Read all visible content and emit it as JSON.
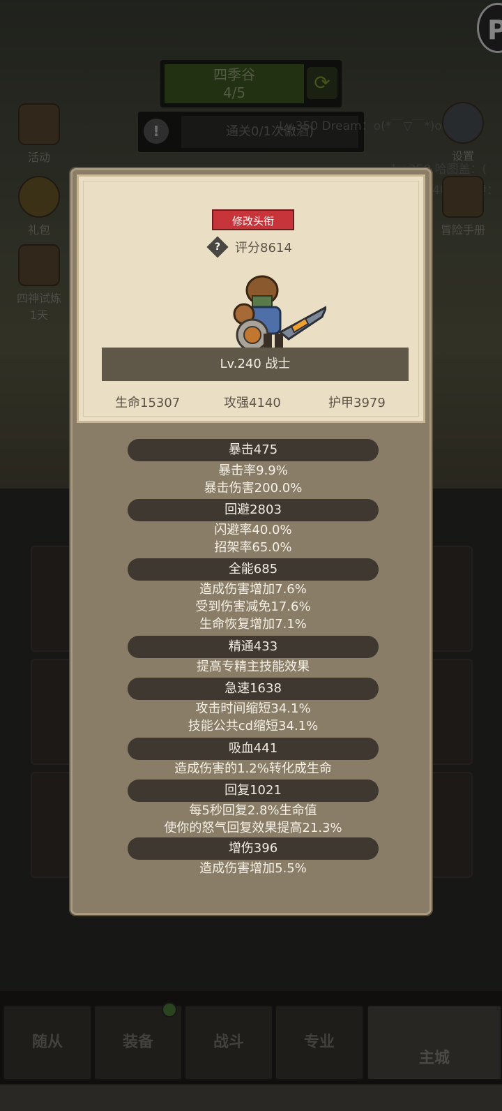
{
  "background": {
    "stage": {
      "name": "四季谷",
      "progress": "4/5"
    },
    "clear_text": "通关0/1次徽酒)",
    "chat": [
      "Lv.350 Dream：o(*￣▽￣*)o",
      "Lv.350 哈图盖：(",
      "40 德鲁伊："
    ],
    "left_icons": [
      {
        "name": "activity",
        "label": "活动"
      },
      {
        "name": "gift",
        "label": "礼包"
      },
      {
        "name": "trial",
        "label": "四神试炼",
        "sub": "1天"
      }
    ],
    "right_icons": [
      {
        "name": "settings",
        "label": "设置"
      },
      {
        "name": "handbook",
        "label": "冒险手册"
      }
    ],
    "top_right": "P",
    "nav": [
      {
        "label": "随从"
      },
      {
        "label": "装备"
      },
      {
        "label": "战斗"
      },
      {
        "label": "专业"
      },
      {
        "label": "主城"
      }
    ]
  },
  "modal": {
    "title_button": "修改头衔",
    "score": "评分8614",
    "hero_level": "Lv.240 战士",
    "base_stats": [
      "生命15307",
      "攻强4140",
      "护甲3979"
    ],
    "stats": [
      {
        "header": "暴击475",
        "lines": [
          "暴击率9.9%",
          "暴击伤害200.0%"
        ]
      },
      {
        "header": "回避2803",
        "lines": [
          "闪避率40.0%",
          "招架率65.0%"
        ]
      },
      {
        "header": "全能685",
        "lines": [
          "造成伤害增加7.6%",
          "受到伤害减免17.6%",
          "生命恢复增加7.1%"
        ]
      },
      {
        "header": "精通433",
        "lines": [
          "提高专精主技能效果"
        ]
      },
      {
        "header": "急速1638",
        "lines": [
          "攻击时间缩短34.1%",
          "技能公共cd缩短34.1%"
        ]
      },
      {
        "header": "吸血441",
        "lines": [
          "造成伤害的1.2%转化成生命"
        ]
      },
      {
        "header": "回复1021",
        "lines": [
          "每5秒回复2.8%生命值",
          "使你的怒气回复效果提高21.3%"
        ]
      },
      {
        "header": "增伤396",
        "lines": [
          "造成伤害增加5.5%"
        ]
      }
    ]
  },
  "colors": {
    "modal_bg": "#8a7d67",
    "card_bg": "#eadfc5",
    "title_button": "#c7353a",
    "stat_header": "#3e3831"
  }
}
